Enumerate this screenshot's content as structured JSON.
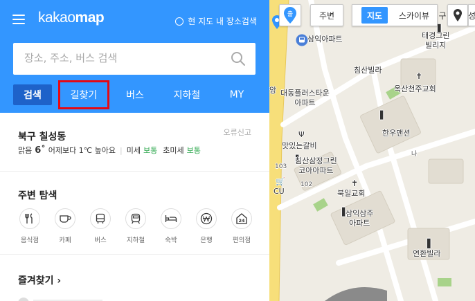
{
  "header": {
    "logo_regular": "kakao",
    "logo_bold": "map",
    "area_search": "현 지도 내 장소검색",
    "accent_color": "#3396ff"
  },
  "search": {
    "placeholder": "장소, 주소, 버스 검색"
  },
  "tabs": [
    {
      "label": "검색",
      "active": true
    },
    {
      "label": "길찾기",
      "highlighted": true
    },
    {
      "label": "버스"
    },
    {
      "label": "지하철"
    },
    {
      "label": "MY"
    }
  ],
  "weather": {
    "region": "북구 칠성동",
    "report_error": "오류신고",
    "condition": "맑음",
    "temperature": "6˚",
    "comparison": "어제보다 1℃ 높아요",
    "fine_dust_label": "미세",
    "fine_dust_value": "보통",
    "ultra_fine_dust_label": "초미세",
    "ultra_fine_dust_value": "보통"
  },
  "nearby": {
    "title": "주변 탐색",
    "items": [
      {
        "label": "음식점",
        "icon": "restaurant-icon"
      },
      {
        "label": "카페",
        "icon": "cafe-icon"
      },
      {
        "label": "버스",
        "icon": "bus-icon"
      },
      {
        "label": "지하철",
        "icon": "subway-icon"
      },
      {
        "label": "숙박",
        "icon": "bed-icon"
      },
      {
        "label": "은행",
        "icon": "won-icon"
      },
      {
        "label": "편의점",
        "icon": "convenience-store-icon"
      }
    ]
  },
  "favorites": {
    "title": "즐겨찾기"
  },
  "map_controls": {
    "location_badge": "출",
    "nearby": "주변",
    "map": "지도",
    "skyview": "스카이뷰",
    "extra": "구",
    "right_edge": "성"
  },
  "map_labels": {
    "samik_apt": "삼익아파트",
    "chimsan_villa": "침산빌라",
    "taegyeong_green": "태경그린\n빌리지",
    "oksan_church": "옥산천주교회",
    "daedong": "대동플러스타운\n아파트",
    "hanwoo": "한우맨션",
    "tasty_galbi": "맛있는갈비",
    "chimsan_samjeong": "침산삼정그린\n코아아파트",
    "n103": "103",
    "n102": "102",
    "cu": "CU",
    "bugil_church": "북일교회",
    "samik_samju": "삼익삼주\n아파트",
    "yeonhwan_villa": "연환빌라",
    "na": "나",
    "left_edge": "앙"
  }
}
